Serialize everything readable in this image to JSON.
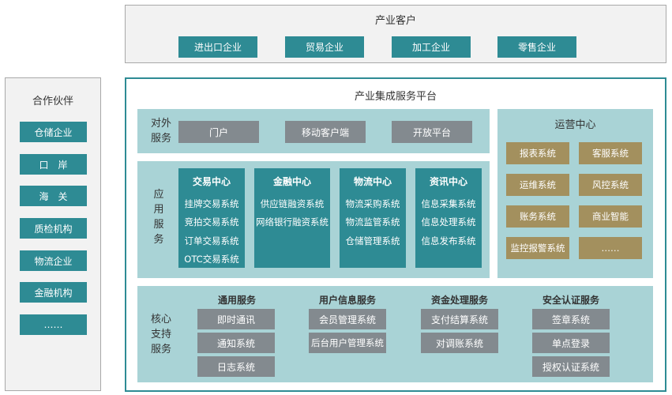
{
  "customers": {
    "title": "产业客户",
    "items": [
      "进出口企业",
      "贸易企业",
      "加工企业",
      "零售企业"
    ]
  },
  "partners": {
    "title": "合作伙伴",
    "items": [
      "仓储企业",
      "口　岸",
      "海　关",
      "质检机构",
      "物流企业",
      "金融机构",
      "……"
    ]
  },
  "platform": {
    "title": "产业集成服务平台",
    "external": {
      "label": "对外\n服务",
      "items": [
        "门户",
        "移动客户端",
        "开放平台"
      ]
    },
    "application": {
      "label": "应\n用\n服\n务",
      "centers": [
        {
          "title": "交易中心",
          "items": [
            "挂牌交易系统",
            "竞拍交易系统",
            "订单交易系统",
            "OTC交易系统"
          ]
        },
        {
          "title": "金融中心",
          "items": [
            "供应链融资系统",
            "网络银行融资系统"
          ]
        },
        {
          "title": "物流中心",
          "items": [
            "物流采购系统",
            "物流监管系统",
            "仓储管理系统"
          ]
        },
        {
          "title": "资讯中心",
          "items": [
            "信息采集系统",
            "信息处理系统",
            "信息发布系统"
          ]
        }
      ]
    },
    "ops": {
      "title": "运营中心",
      "items": [
        "报表系统",
        "客服系统",
        "运维系统",
        "风控系统",
        "账务系统",
        "商业智能",
        "监控报警系统",
        "……"
      ]
    },
    "core": {
      "label": "核心\n支持\n服务",
      "groups": [
        {
          "title": "通用服务",
          "items": [
            "即时通讯",
            "通知系统",
            "日志系统"
          ]
        },
        {
          "title": "用户信息服务",
          "items": [
            "会员管理系统",
            "后台用户管理系统"
          ]
        },
        {
          "title": "资金处理服务",
          "items": [
            "支付结算系统",
            "对调账系统"
          ]
        },
        {
          "title": "安全认证服务",
          "items": [
            "签章系统",
            "单点登录",
            "授权认证系统"
          ]
        }
      ]
    }
  }
}
